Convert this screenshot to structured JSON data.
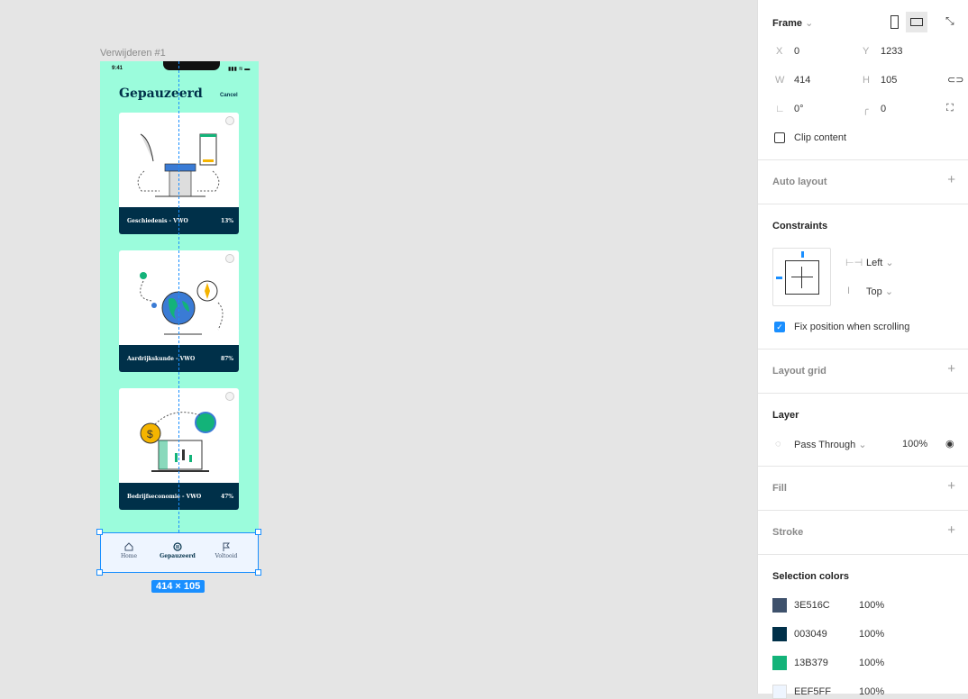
{
  "canvas": {
    "frame_name": "Verwijderen #1",
    "selection_size": "414 × 105"
  },
  "phone": {
    "time": "9:41",
    "status": "▮▮▮ ≋ ▬",
    "title": "Gepauzeerd",
    "cancel": "Cancel",
    "cards": [
      {
        "name": "Geschiedenis - VWO",
        "percent": "13%",
        "illustration": "history-column-hourglass"
      },
      {
        "name": "Aardrijkskunde - VWO",
        "percent": "87%",
        "illustration": "globe-compass"
      },
      {
        "name": "Bedrijfseconomie - VWO",
        "percent": "47%",
        "illustration": "laptop-coins-chart"
      }
    ],
    "tabs": [
      {
        "label": "Home",
        "icon": "home-icon"
      },
      {
        "label": "Gepauzeerd",
        "icon": "pause-icon",
        "active": true
      },
      {
        "label": "Voltooid",
        "icon": "flag-icon"
      }
    ]
  },
  "panel": {
    "frame": {
      "title": "Frame",
      "x_label": "X",
      "x": "0",
      "y_label": "Y",
      "y": "1233",
      "w_label": "W",
      "w": "414",
      "h_label": "H",
      "h": "105",
      "rotation": "0°",
      "radius": "0",
      "clip_content": "Clip content",
      "clip_checked": false
    },
    "auto_layout": "Auto layout",
    "constraints": {
      "title": "Constraints",
      "horizontal": "Left",
      "vertical": "Top",
      "fix_position": "Fix position when scrolling",
      "fix_checked": true
    },
    "layout_grid": "Layout grid",
    "layer": {
      "title": "Layer",
      "blend": "Pass Through",
      "opacity": "100%"
    },
    "fill": "Fill",
    "stroke": "Stroke",
    "selection_colors": {
      "title": "Selection colors",
      "colors": [
        {
          "hex": "3E516C",
          "opacity": "100%"
        },
        {
          "hex": "003049",
          "opacity": "100%"
        },
        {
          "hex": "13B379",
          "opacity": "100%"
        },
        {
          "hex": "EEF5FF",
          "opacity": "100%"
        }
      ]
    }
  },
  "colors": {
    "accent": "#1a8fff",
    "phone_bg": "#9bfcdc",
    "navy": "#003049"
  }
}
